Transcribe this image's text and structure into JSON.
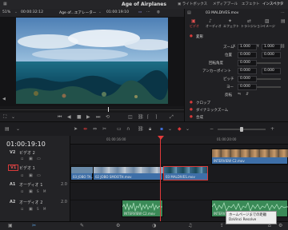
{
  "app": {
    "project_title": "Age of Airplanes",
    "buttons_right": [
      "ライトボックス",
      "メディアプール",
      "エフェクト",
      "インスペクタ"
    ],
    "left_tabs": [
      "メディアプール"
    ]
  },
  "viewer": {
    "zoom": "51%",
    "timecode_left": "00:00:32:12",
    "clip_name": "Age of...エアレーター",
    "timecode_right": "01:00:19:10",
    "clip_file": "03 MALDIVES.mov"
  },
  "inspector": {
    "tabs": [
      "ビデオ",
      "オーディオ",
      "エフェクト",
      "トランジション",
      "イメージ",
      "ファイル"
    ],
    "section_transform": "変形",
    "zoom_label": "ズーム",
    "zoom_x": "X",
    "zoom_x_value": "1.000",
    "zoom_y": "Y",
    "zoom_y_value": "1.000",
    "position_label": "位置",
    "position_x_value": "0.000",
    "position_y_value": "0.000",
    "rotation_label": "回転角度",
    "rotation_value": "0.000",
    "anchor_label": "アンカーポイント",
    "anchor_x_value": "0.000",
    "anchor_y_value": "0.000",
    "pitch_label": "ピッチ",
    "pitch_value": "0.000",
    "yaw_label": "ヨー",
    "yaw_value": "0.000",
    "flip_label": "反転",
    "section_crop": "クロップ",
    "section_dynamic_zoom": "ダイナミックズーム",
    "section_composite": "合成"
  },
  "timeline": {
    "timecode": "01:00:19:10",
    "ruler": [
      "01:00:16:00",
      "01:00:20:00"
    ],
    "tracks": [
      {
        "id": "V2",
        "name": "ビデオ 2",
        "count": ""
      },
      {
        "id": "V1",
        "name": "ビデオ 1",
        "count": ""
      },
      {
        "id": "A1",
        "name": "オーディオ 1",
        "count": "2.0"
      },
      {
        "id": "A2",
        "name": "オーディオ 2",
        "count": "2.0"
      }
    ],
    "clips": {
      "v2_clip": "INTERVIEW C2.mov",
      "v1_clip_a": "03 JOBO TA...",
      "v1_clip_b": "02 JOBO SMOOTH.mov",
      "v1_clip_c": "03 MALDIVES.mov",
      "a1_clip": "",
      "a2_clip_a": "INTERVIEW C2.mov",
      "a2_clip_b": "INTERVIEW C2.mov"
    }
  },
  "tooltip": {
    "line1": "ホームページまでの距離",
    "line2": "DaVinci Resolve"
  },
  "colors": {
    "accent_red": "#d93a3a",
    "clip_blue": "#3e6fa8",
    "clip_green": "#3a8a57",
    "playhead": "#e23a3a"
  }
}
